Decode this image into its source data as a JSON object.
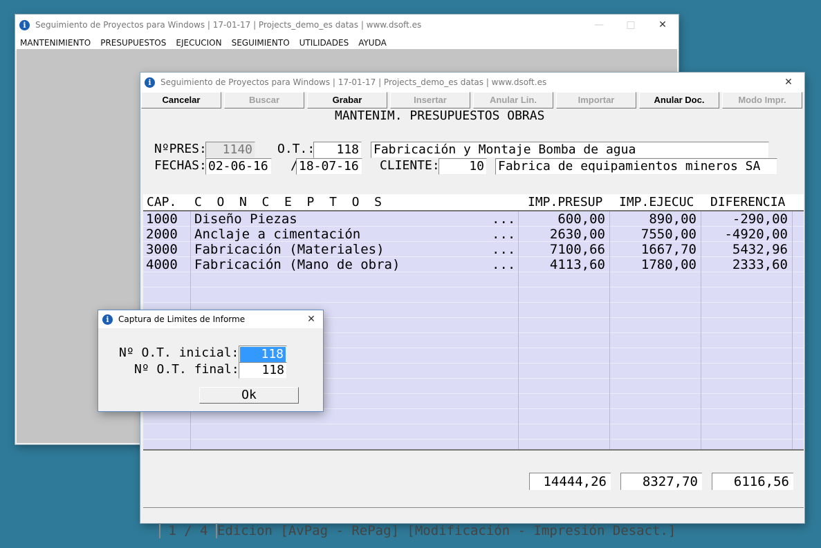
{
  "main_window": {
    "title": "Seguimiento de Proyectos para Windows  |  17-01-17  |  Projects_demo_es datas  |  www.dsoft.es",
    "menu": [
      "MANTENIMIENTO",
      "PRESUPUESTOS",
      "EJECUCION",
      "SEGUIMIENTO",
      "UTILIDADES",
      "AYUDA"
    ]
  },
  "child_window": {
    "title": "Seguimiento de Proyectos para Windows  |  17-01-17  |  Projects_demo_es datas |  www.dsoft.es",
    "toolbar": [
      {
        "label": "Cancelar",
        "enabled": true
      },
      {
        "label": "Buscar",
        "enabled": false
      },
      {
        "label": "Grabar",
        "enabled": true
      },
      {
        "label": "Insertar",
        "enabled": false
      },
      {
        "label": "Anular Lin.",
        "enabled": false
      },
      {
        "label": "Importar",
        "enabled": false
      },
      {
        "label": "Anular Doc.",
        "enabled": true
      },
      {
        "label": "Modo Impr.",
        "enabled": false
      }
    ],
    "heading": "MANTENIM. PRESUPUESTOS OBRAS",
    "form": {
      "npres_label": "NºPRES:",
      "npres_value": "1140",
      "ot_label": "O.T.:",
      "ot_value": "118",
      "ot_desc": "Fabricación y Montaje Bomba de agua",
      "fechas_label": "FECHAS:",
      "fecha_ini": "02-06-16",
      "fecha_sep": "/",
      "fecha_fin": "18-07-16",
      "cliente_label": "CLIENTE:",
      "cliente_value": "10",
      "cliente_desc": "Fabrica de equipamientos mineros SA"
    },
    "grid": {
      "headers": {
        "cap": "CAP.",
        "conceptos": "C  O  N  C  E  P  T  O  S",
        "imp_presup": "IMP.PRESUP",
        "imp_ejecuc": "IMP.EJECUC",
        "diferencia": "DIFERENCIA"
      },
      "rows": [
        {
          "cap": "1000",
          "concepto": "Diseño Piezas",
          "more": "...",
          "presup": "600,00",
          "ejecuc": "890,00",
          "dif": "-290,00"
        },
        {
          "cap": "2000",
          "concepto": "Anclaje a cimentación",
          "more": "...",
          "presup": "2630,00",
          "ejecuc": "7550,00",
          "dif": "-4920,00"
        },
        {
          "cap": "3000",
          "concepto": "Fabricación (Materiales)",
          "more": "...",
          "presup": "7100,66",
          "ejecuc": "1667,70",
          "dif": "5432,96"
        },
        {
          "cap": "4000",
          "concepto": "Fabricación (Mano de obra)",
          "more": "...",
          "presup": "4113,60",
          "ejecuc": "1780,00",
          "dif": "2333,60"
        }
      ]
    },
    "totals": {
      "presup": "14444,26",
      "ejecuc": "8327,70",
      "dif": "6116,56"
    },
    "status": {
      "page": " 1 / 4",
      "text": "Edicion [AvPag - RePag] [Modificación - Impresión Desact.]"
    }
  },
  "dialog": {
    "title": "Captura de Limites de Informe",
    "ot_inicial_label": "Nº O.T. inicial:",
    "ot_inicial_value": "118",
    "ot_final_label": "Nº O.T. final:",
    "ot_final_value": "118",
    "ok_label": "Ok"
  },
  "colors": {
    "desktop": "#2f7a98",
    "grid_bg": "#dcdcf6",
    "selection": "#3399ff"
  }
}
